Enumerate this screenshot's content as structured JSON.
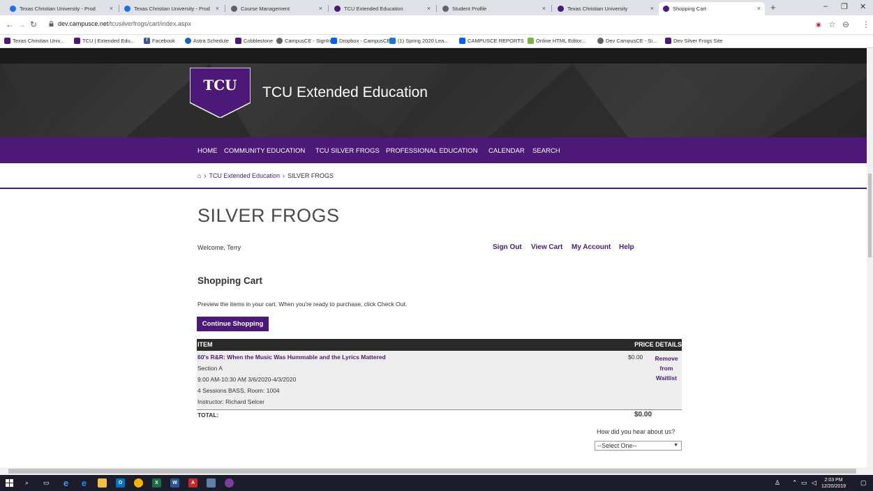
{
  "browser": {
    "tabs": [
      {
        "title": "Texas Christian University - Prod",
        "close": "×"
      },
      {
        "title": "Texas Christian University - Prod",
        "close": "×"
      },
      {
        "title": "Course Management",
        "close": "×"
      },
      {
        "title": "TCU Extended Education",
        "close": "×"
      },
      {
        "title": "Student Profile",
        "close": "×"
      },
      {
        "title": "Texas Christian University",
        "close": "×"
      },
      {
        "title": "Shopping Cart",
        "close": "×"
      }
    ],
    "new_tab": "+",
    "window_controls": [
      "–",
      "❐",
      "✕"
    ],
    "url_host": "dev.campusce.net",
    "url_path": "/tcusilverfrogs/cart/index.aspx",
    "bookmarks": [
      "Texas Christian Univ...",
      "TCU | Extended Edu...",
      "Facebook",
      "Astra Schedule",
      "Cobblestone",
      "CampusCE - SignIn",
      "Dropbox - CampusCE",
      "(1) Spring 2020 Lea...",
      "CAMPUSCE REPORTS",
      "Online HTML Editor...",
      "Dev CampusCE - Si...",
      "Dev Silver Frogs Site"
    ]
  },
  "site": {
    "logo_text": "TCU",
    "brand": "TCU Extended Education",
    "nav": [
      "HOME",
      "COMMUNITY EDUCATION",
      "TCU SILVER FROGS",
      "PROFESSIONAL EDUCATION",
      "CALENDAR",
      "SEARCH"
    ],
    "breadcrumb": {
      "home_icon": "⌂",
      "sep": "›",
      "link": "TCU Extended Education",
      "current": "SILVER FROGS"
    }
  },
  "page": {
    "title": "SILVER FROGS",
    "welcome": "Welcome, Terry",
    "links": [
      "Sign Out",
      "View Cart",
      "My Account",
      "Help"
    ],
    "cart_heading": "Shopping Cart",
    "intro": "Preview the items in your cart. When you're ready to purchase, click Check Out.",
    "continue_button": "Continue Shopping"
  },
  "cart": {
    "col_item": "ITEM",
    "col_price": "PRICE DETAILS",
    "items": [
      {
        "title": "60's R&R: When the Music Was Hummable and the Lyrics Mattered",
        "section": "Section A",
        "schedule": "9:00 AM-10:30 AM 3/6/2020-4/3/2020",
        "sessions": "4 Sessions BASS, Room: 1004",
        "instructor": "Instructor: Richard Selcer",
        "price": "$0.00",
        "action": "Remove from Waitlist"
      }
    ],
    "total_label": "TOTAL:",
    "total_value": "$0.00",
    "hear_label": "How did you hear about us?",
    "hear_selected": "--Select One--"
  },
  "taskbar": {
    "time": "2:03 PM",
    "date": "12/20/2019"
  },
  "colors": {
    "tcu_purple": "#4d1979",
    "banner_dark": "#2b2b2b"
  }
}
